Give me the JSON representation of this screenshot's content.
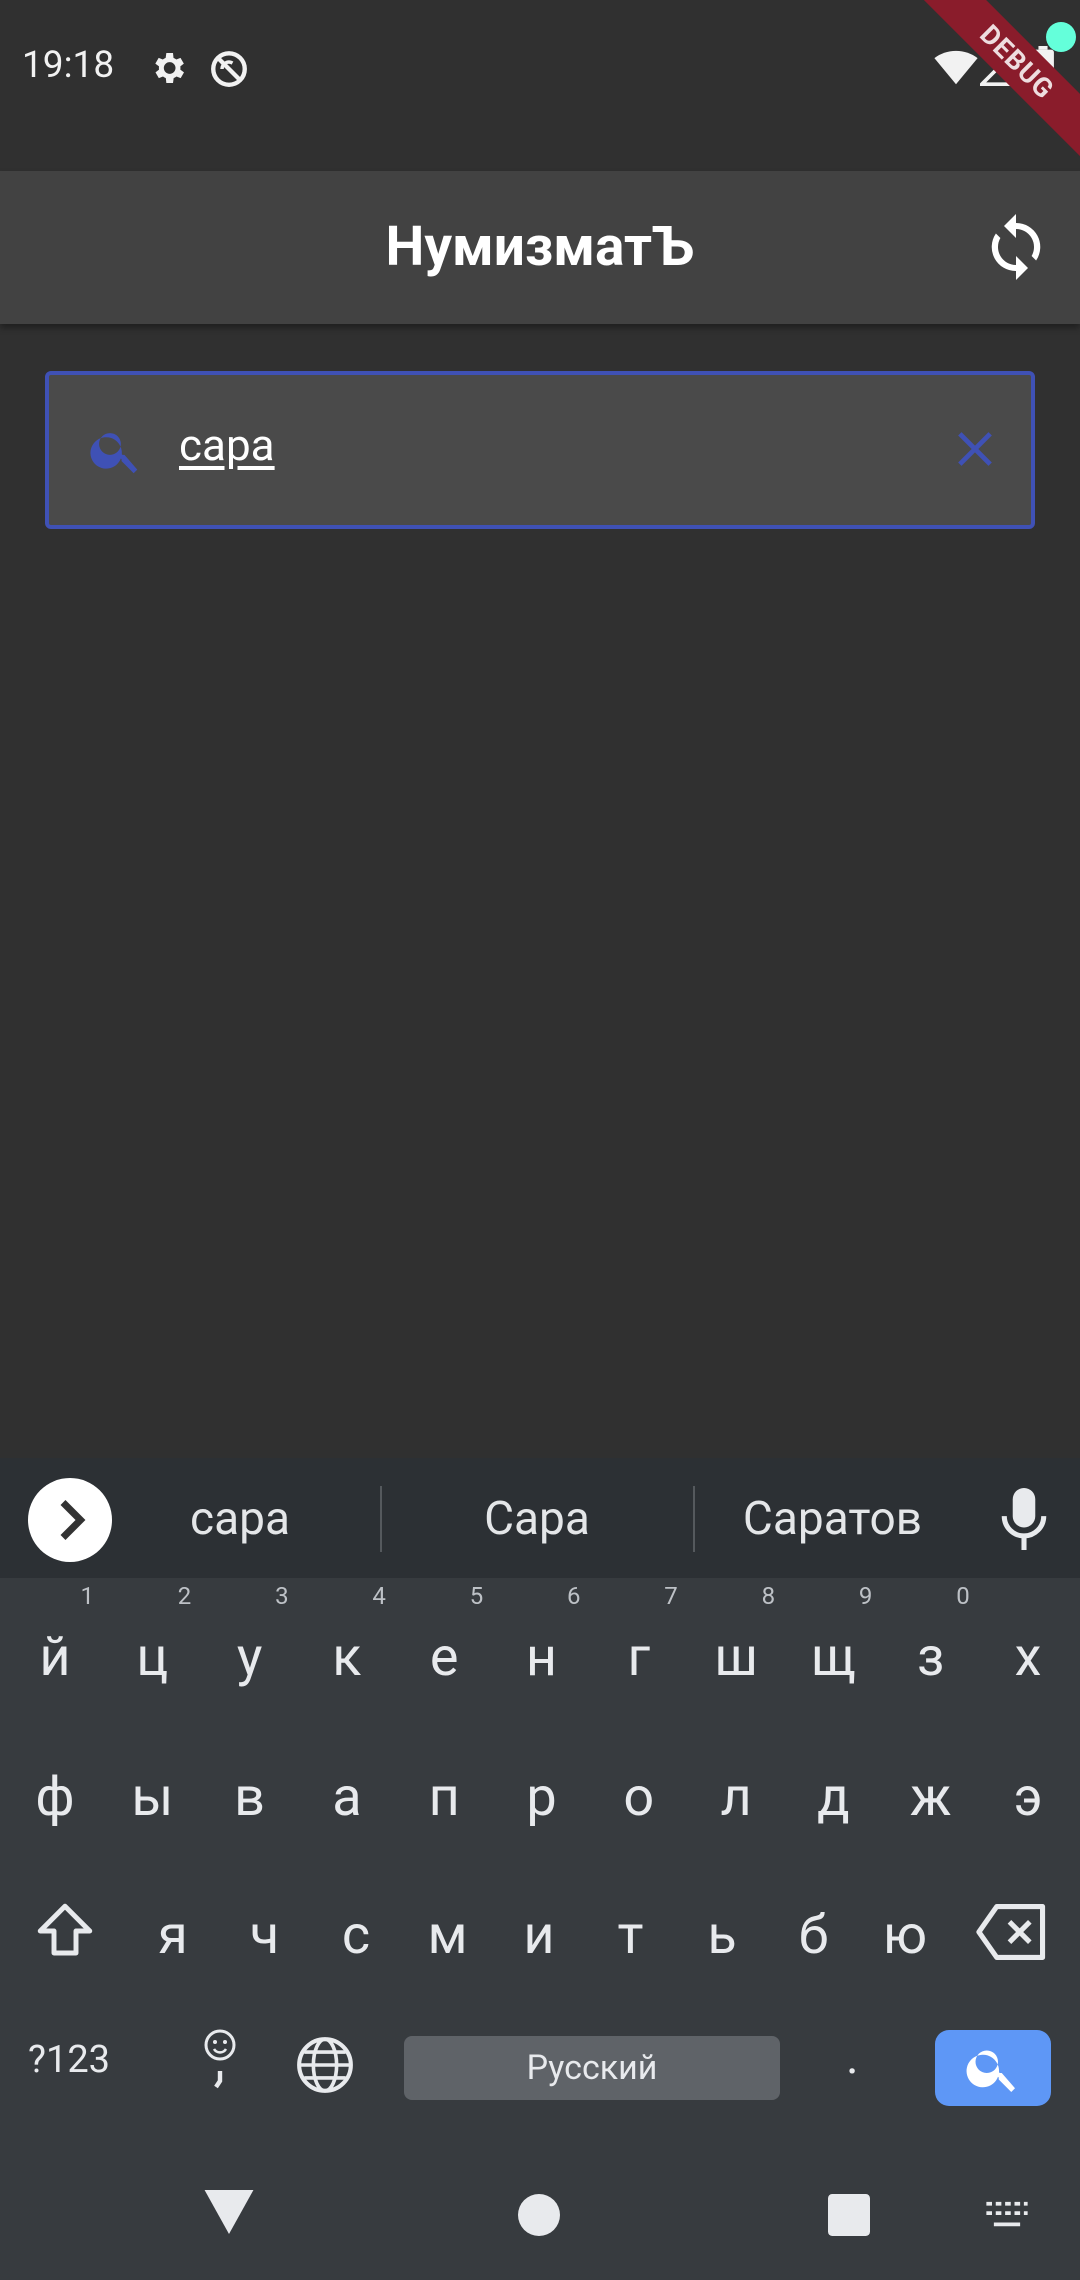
{
  "status_bar": {
    "time": "19:18",
    "icons": [
      "settings-icon",
      "no-sync-icon",
      "wifi-icon",
      "signal-icon",
      "battery-icon"
    ]
  },
  "debug_banner": "DEBUG",
  "app_bar": {
    "title": "НумизматЪ",
    "sync_icon": "sync-icon",
    "status_dot_color": "#64ffda"
  },
  "search": {
    "value": "сара",
    "border_color": "#3f51b5"
  },
  "keyboard": {
    "suggestions": [
      "сара",
      "Сара",
      "Саратов"
    ],
    "row1": [
      {
        "k": "й",
        "h": "1"
      },
      {
        "k": "ц",
        "h": "2"
      },
      {
        "k": "у",
        "h": "3"
      },
      {
        "k": "к",
        "h": "4"
      },
      {
        "k": "е",
        "h": "5"
      },
      {
        "k": "н",
        "h": "6"
      },
      {
        "k": "г",
        "h": "7"
      },
      {
        "k": "ш",
        "h": "8"
      },
      {
        "k": "щ",
        "h": "9"
      },
      {
        "k": "з",
        "h": "0"
      },
      {
        "k": "х",
        "h": ""
      }
    ],
    "row2": [
      "ф",
      "ы",
      "в",
      "а",
      "п",
      "р",
      "о",
      "л",
      "д",
      "ж",
      "э"
    ],
    "row3": [
      "я",
      "ч",
      "с",
      "м",
      "и",
      "т",
      "ь",
      "б",
      "ю"
    ],
    "symbols_label": "?123",
    "emoji_label": "☺\n,",
    "space_label": "Русский",
    "period_label": ".",
    "action_color": "#5e97f6"
  }
}
